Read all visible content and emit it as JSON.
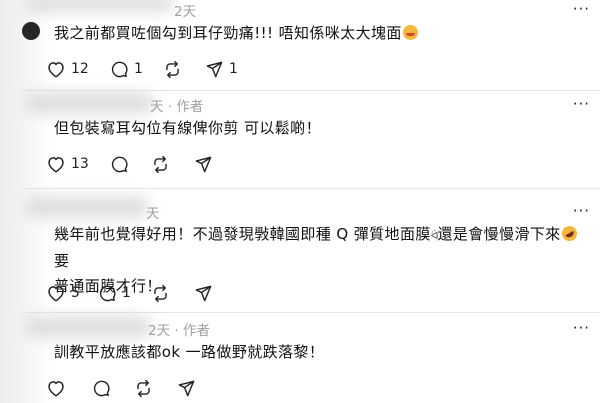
{
  "comments": [
    {
      "time": "2天",
      "author_suffix": "",
      "text": "我之前都買咗個勾到耳仔勁痛!!! 唔知係咪太大塊面",
      "likes": "12",
      "replies": "1",
      "reposts": "",
      "shares": "1"
    },
    {
      "time": "天",
      "author_suffix": "· 作者",
      "text": "但包裝寫耳勾位有線俾你剪 可以鬆啲！",
      "likes": "13",
      "replies": "",
      "reposts": "",
      "shares": ""
    },
    {
      "time": "天",
      "author_suffix": "",
      "text_line1": "幾年前也覺得好用！不過發現斅韓國即種 Q 彈質地面膜",
      "kaomoji": "ᐛ",
      "text_line1_tail": "還是會慢慢滑下來",
      "text_line1_end": "要",
      "text_line2": "普通面膜才行！",
      "likes": "5",
      "replies": "1",
      "reposts": "",
      "shares": ""
    },
    {
      "time": "2天",
      "author_suffix": "· 作者",
      "text": "訓教平放應該都ok 一路做野就跌落黎！",
      "likes": "",
      "replies": "",
      "reposts": "",
      "shares": ""
    }
  ],
  "more_label": "···",
  "icons": [
    "heart-icon",
    "comment-icon",
    "repost-icon",
    "share-icon",
    "more-icon"
  ]
}
